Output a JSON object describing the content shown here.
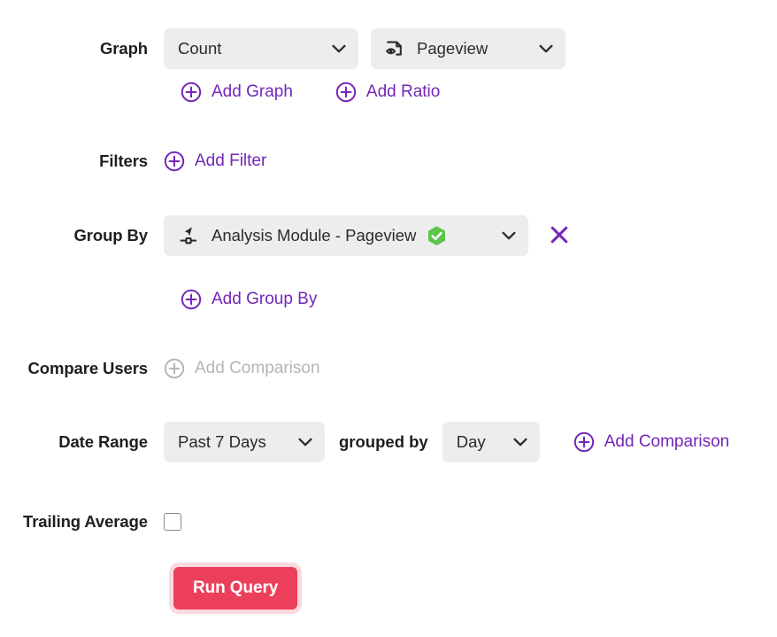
{
  "rows": {
    "graph": {
      "label": "Graph",
      "metric": {
        "value": "Count",
        "icon": "chevron-down-icon"
      },
      "event": {
        "value": "Pageview",
        "icon": "pageview-icon"
      },
      "add_graph": "Add Graph",
      "add_ratio": "Add Ratio"
    },
    "filters": {
      "label": "Filters",
      "add_filter": "Add Filter"
    },
    "group_by": {
      "label": "Group By",
      "value": "Analysis Module - Pageview",
      "icon": "analysis-module-icon",
      "badge": "verified-check-badge",
      "remove": "remove-group-by",
      "add_group_by": "Add Group By"
    },
    "compare_users": {
      "label": "Compare Users",
      "add_comparison": "Add Comparison",
      "disabled": true
    },
    "date_range": {
      "label": "Date Range",
      "range_value": "Past 7 Days",
      "grouped_by_text": "grouped by",
      "interval_value": "Day",
      "add_comparison": "Add Comparison"
    },
    "trailing_average": {
      "label": "Trailing Average",
      "checked": false
    },
    "run": {
      "label": "Run Query"
    }
  },
  "colors": {
    "accent_purple": "#7326b8",
    "run_button": "#ec3f5c",
    "run_button_ring": "#fbd9e0",
    "pill_background": "#ededed",
    "badge_green": "#5cc44a",
    "disabled_grey": "#b5b5b5"
  }
}
